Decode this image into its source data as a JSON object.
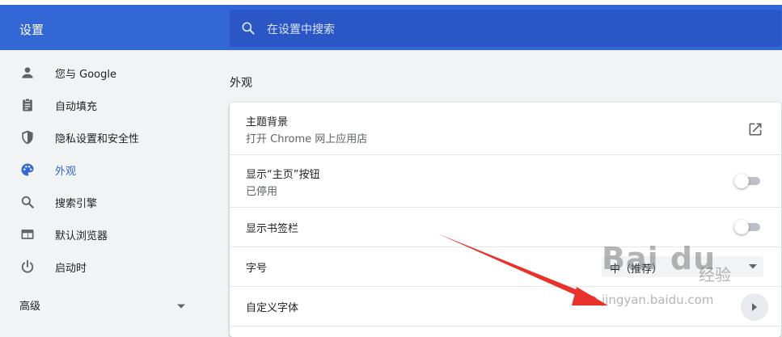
{
  "header": {
    "title": "设置",
    "search_placeholder": "在设置中搜索"
  },
  "sidebar": {
    "items": [
      {
        "label": "您与 Google",
        "icon": "person-icon"
      },
      {
        "label": "自动填充",
        "icon": "clipboard-icon"
      },
      {
        "label": "隐私设置和安全性",
        "icon": "shield-icon"
      },
      {
        "label": "外观",
        "icon": "palette-icon",
        "active": true
      },
      {
        "label": "搜索引擎",
        "icon": "search-icon"
      },
      {
        "label": "默认浏览器",
        "icon": "browser-window-icon"
      },
      {
        "label": "启动时",
        "icon": "power-icon"
      }
    ],
    "advanced_label": "高级"
  },
  "main": {
    "section_title": "外观",
    "rows": [
      {
        "label": "主题背景",
        "sublabel": "打开 Chrome 网上应用店",
        "control": "external-link"
      },
      {
        "label": "显示“主页”按钮",
        "sublabel": "已停用",
        "control": "toggle",
        "on": false
      },
      {
        "label": "显示书签栏",
        "control": "toggle",
        "on": false
      },
      {
        "label": "字号",
        "control": "select",
        "value": "中（推荐）"
      },
      {
        "label": "自定义字体",
        "control": "arrow"
      }
    ]
  },
  "watermark": {
    "main": "Bai du",
    "cn": "经验",
    "url": "jingyan.baidu.com"
  },
  "colors": {
    "accent": "#3367d6",
    "search_bg": "#2a56c6",
    "annotation_arrow": "#e8322b"
  }
}
